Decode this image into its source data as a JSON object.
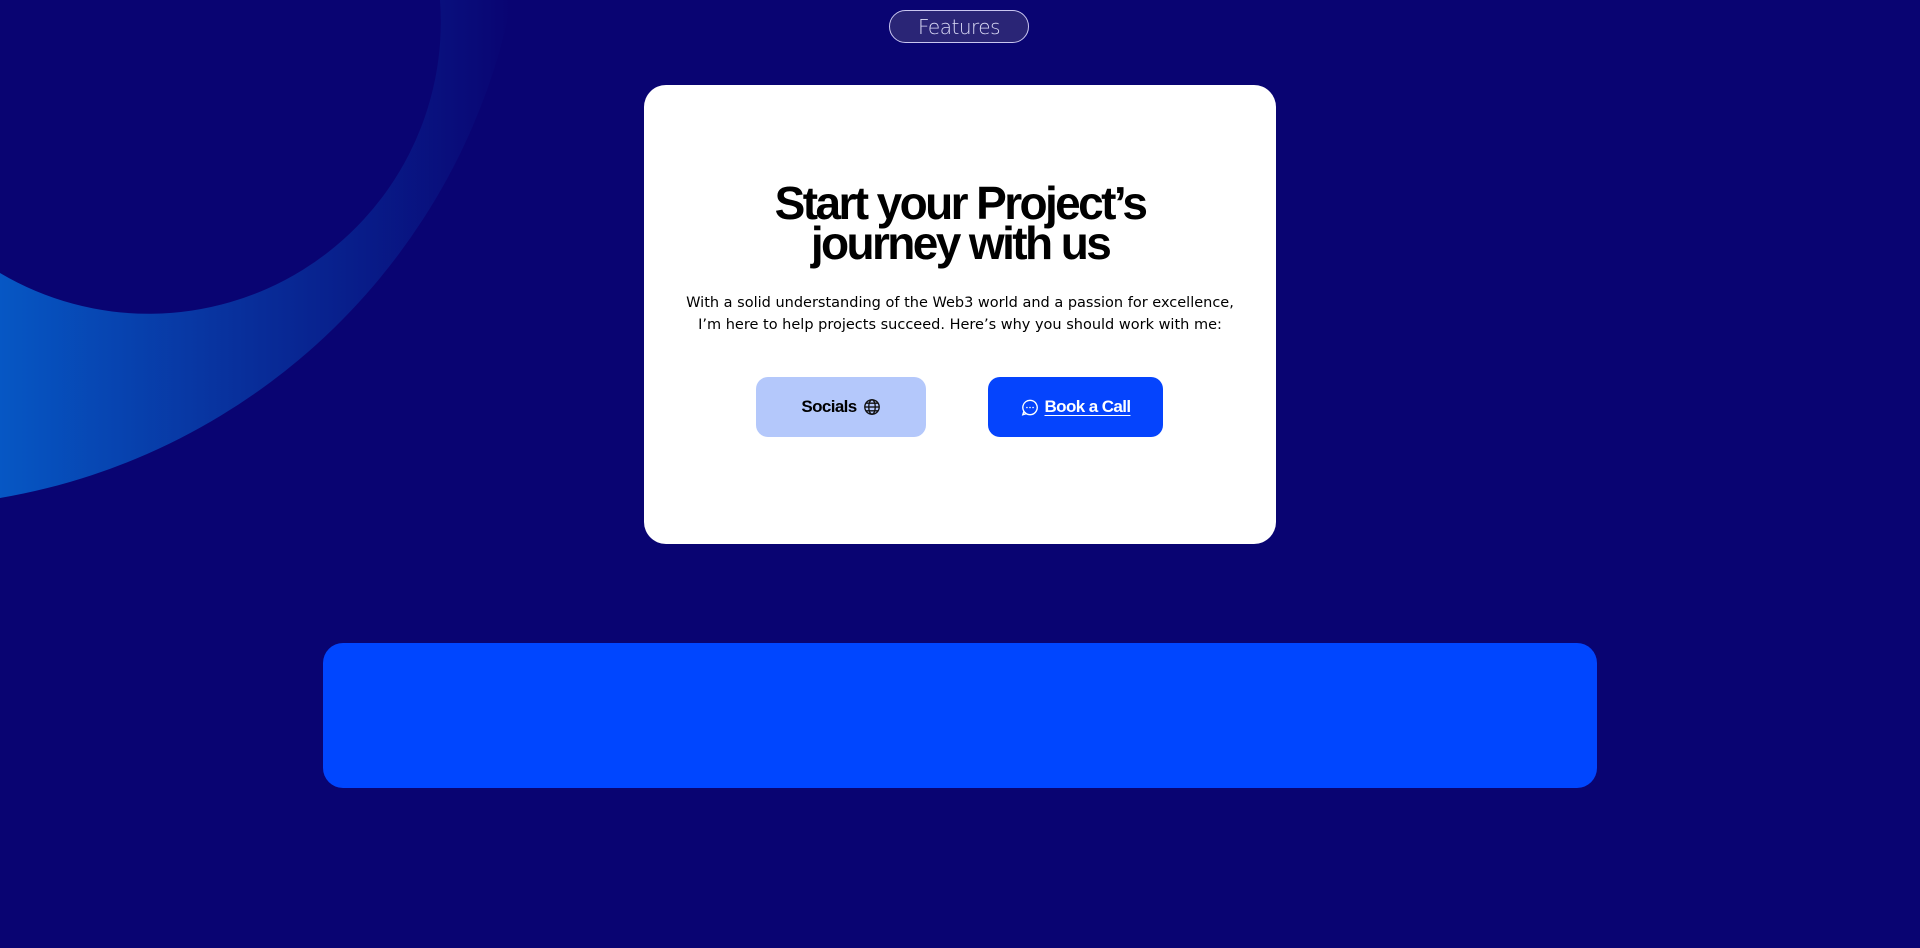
{
  "nav": {
    "features_label": "Features"
  },
  "hero": {
    "title_line1": "Start your Project’s",
    "title_line2": "journey with us",
    "description_line1": "With a solid understanding of the Web3 world and a passion for excellence,",
    "description_line2": "I’m here to help projects succeed. Here’s why you should work with me:"
  },
  "buttons": {
    "socials_label": "Socials",
    "socials_icon": "globe-icon",
    "book_call_label": "Book a Call",
    "book_call_icon": "chat-bubble-icon"
  },
  "colors": {
    "background": "#090472",
    "card": "#ffffff",
    "socials_button": "#b4c8fb",
    "primary_button": "#0544fd",
    "banner": "#0046ff",
    "arc_gradient_start": "#0a5bd0",
    "arc_gradient_end": "#090472"
  }
}
